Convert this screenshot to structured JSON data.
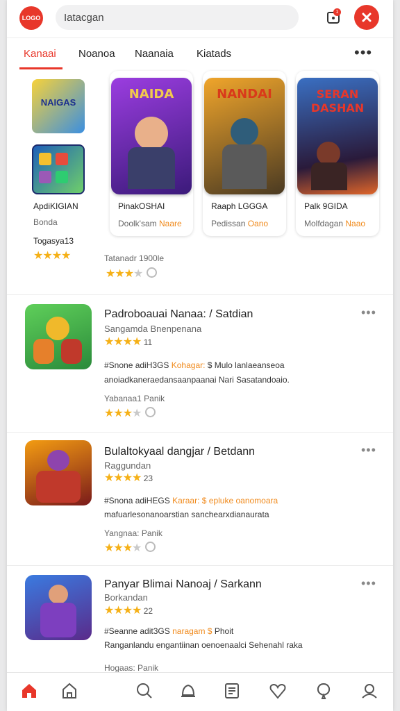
{
  "header": {
    "logo_text": "LOGO",
    "search_value": "Iatacgan",
    "notification_count": "1"
  },
  "tabs": [
    {
      "label": "Kanaai",
      "active": true
    },
    {
      "label": "Noanoa",
      "active": false
    },
    {
      "label": "Naanaia",
      "active": false
    },
    {
      "label": "Kiatads",
      "active": false
    }
  ],
  "tab_more": "•••",
  "featured": {
    "side_card": {
      "cover_text": "NAIGAS",
      "name": "ApdiKIGIAN",
      "sub": "Bonda",
      "extra": "Togasya13",
      "stars": 3.5
    },
    "cards": [
      {
        "name": "PinakOSHAI",
        "sub": "Doolk'sam",
        "sub_accent": "Naare",
        "cover_text": "NAIDA",
        "accent": "#7b2fd1"
      },
      {
        "name": "Raaph LGGGA",
        "sub": "Pedissan",
        "sub_accent": "Oano",
        "cover_text": "NANDAI",
        "accent": "#c8891c"
      },
      {
        "name": "Palk 9GIDA",
        "sub": "Molfdagan",
        "sub_accent": "Naao",
        "cover_text": "SERAN DASHAN",
        "accent": "#1c4a8a"
      }
    ],
    "rating_label": "Tatanadr 1900le",
    "rating_stars": 3
  },
  "list": [
    {
      "title": "Padroboauai Nanaa: / Satdian",
      "sub": "Sangamda Bnenpenana",
      "rating": "11",
      "desc_prefix": "#Snone adiH3GS",
      "desc_accent": "Kohagar:",
      "desc_suffix": "$ Mulo lanlaeanseoa",
      "desc2": "anoiadkaneraedansaanpaanai Nari Sasatandoaio.",
      "meta": "Yabanaa1 Panik",
      "stars": 3,
      "icon_bg": "#3fae4a",
      "icon_accent": "#f0b92b"
    },
    {
      "title": "Bulaltokyaal dangjar / Betdann",
      "sub": "Raggundan",
      "rating": "23",
      "desc_prefix": "#Snona adiHEGS",
      "desc_accent": "Karaar: $ epluke oanomoara",
      "desc_suffix": "",
      "desc2": "mafuarlesonanoarstian sanchearxdianaurata",
      "meta": "Yangnaa: Panik",
      "stars": 3,
      "icon_bg": "#c0392b",
      "icon_accent": "#f39c12"
    },
    {
      "title": "Panyar Blimai Nanoaj / Sarkann",
      "sub": "Borkandan",
      "rating": "22",
      "desc_prefix": "#Seanne adit3GS",
      "desc_accent": "naragam $",
      "desc_suffix": "Phoit",
      "desc2": "Ranganlandu engantiinan oenoenaalci Sehenahl raka",
      "meta": "Hogaas: Panik",
      "stars": 3,
      "icon_bg": "#2b67c7",
      "icon_accent": "#9b59b6"
    }
  ],
  "bottom_nav": [
    {
      "icon": "home-icon",
      "active": true
    },
    {
      "icon": "store-icon",
      "active": false
    },
    {
      "icon": "search-icon",
      "active": false
    },
    {
      "icon": "bell-icon",
      "active": false
    },
    {
      "icon": "news-icon",
      "active": false
    },
    {
      "icon": "heart-icon",
      "active": false
    },
    {
      "icon": "balloon-icon",
      "active": false
    },
    {
      "icon": "user-icon",
      "active": false
    }
  ],
  "colors": {
    "accent": "#e8372a",
    "star": "#f5b016",
    "orange_text": "#f08a1c"
  }
}
